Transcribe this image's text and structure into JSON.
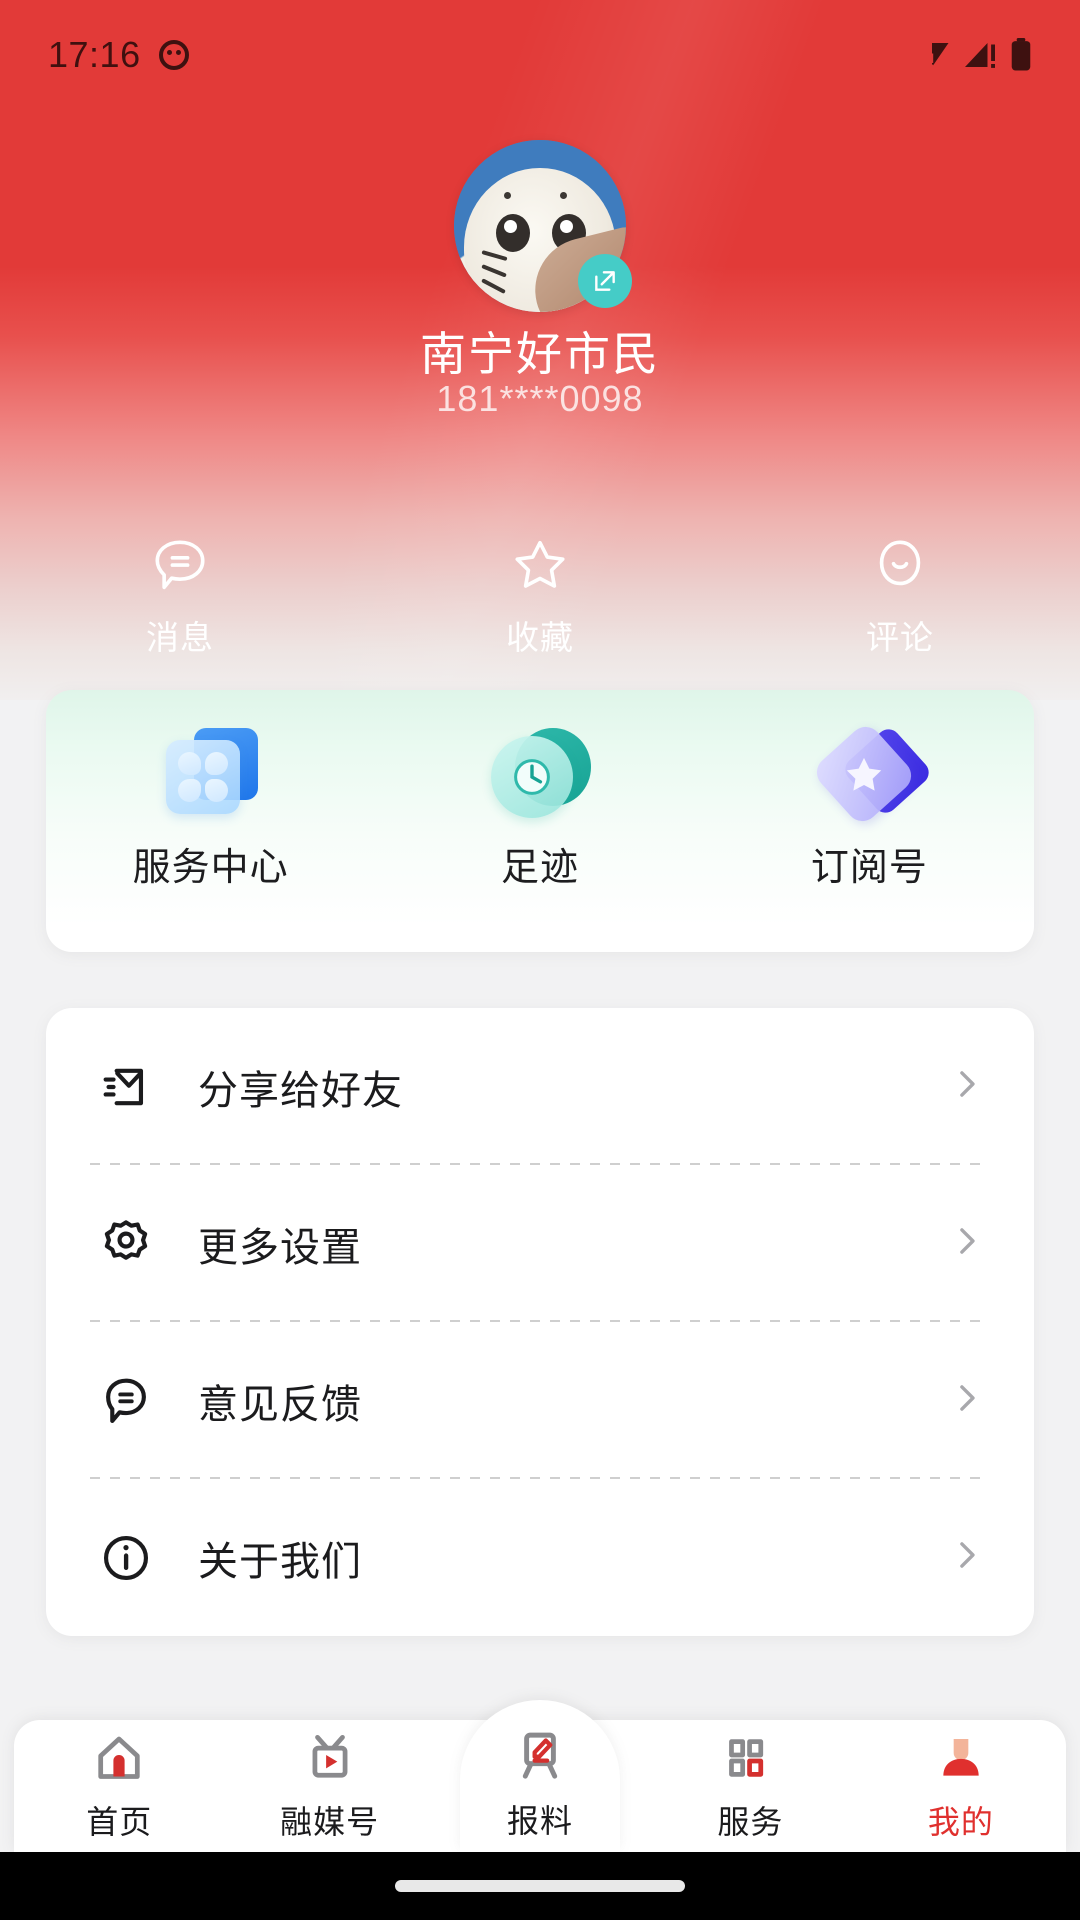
{
  "status_bar": {
    "time": "17:16",
    "app_icon": "cat-face-icon",
    "wifi_icon": "wifi-icon",
    "signal_icon": "cellular-signal-icon",
    "battery_icon": "battery-full-icon"
  },
  "profile": {
    "avatar_alt": "user-avatar",
    "edit_badge_icon": "edit-pencil-icon",
    "name": "南宁好市民",
    "phone": "181****0098",
    "header_color": "#e23a38"
  },
  "quick_actions": [
    {
      "label": "消息",
      "icon": "message-bubble-icon",
      "name": "messages"
    },
    {
      "label": "收藏",
      "icon": "star-icon",
      "name": "favorites"
    },
    {
      "label": "评论",
      "icon": "comment-smile-icon",
      "name": "comments"
    }
  ],
  "service_card": {
    "items": [
      {
        "label": "服务中心",
        "icon": "service-grid-icon",
        "name": "service-center",
        "color": "#1f76ea"
      },
      {
        "label": "足迹",
        "icon": "clock-history-icon",
        "name": "footprints",
        "color": "#17a394"
      },
      {
        "label": "订阅号",
        "icon": "star-badge-icon",
        "name": "subscriptions",
        "color": "#3a2ae0"
      }
    ]
  },
  "menu": {
    "items": [
      {
        "label": "分享给好友",
        "icon": "share-envelope-icon",
        "name": "share-to-friends"
      },
      {
        "label": "更多设置",
        "icon": "gear-icon",
        "name": "more-settings"
      },
      {
        "label": "意见反馈",
        "icon": "feedback-bubble-icon",
        "name": "feedback"
      },
      {
        "label": "关于我们",
        "icon": "info-circle-icon",
        "name": "about-us"
      }
    ],
    "chevron_icon": "chevron-right-icon"
  },
  "tab_bar": {
    "active_color": "#e0302e",
    "inactive_color": "#1b1b1d",
    "tabs": [
      {
        "label": "首页",
        "icon": "home-icon",
        "name": "tab-home",
        "active": false
      },
      {
        "label": "融媒号",
        "icon": "tv-play-icon",
        "name": "tab-media",
        "active": false
      },
      {
        "label": "报料",
        "icon": "easel-pen-icon",
        "name": "tab-report",
        "active": false
      },
      {
        "label": "服务",
        "icon": "grid-icon",
        "name": "tab-service",
        "active": false
      },
      {
        "label": "我的",
        "icon": "person-icon",
        "name": "tab-mine",
        "active": true
      }
    ]
  },
  "system_nav": {
    "gesture_bar": "home-gesture-indicator"
  }
}
